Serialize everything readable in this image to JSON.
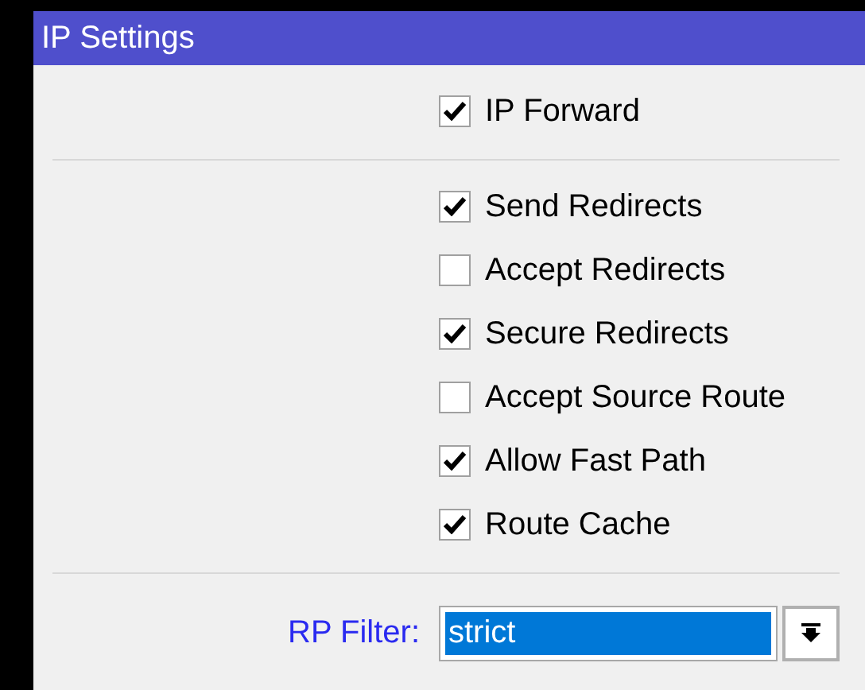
{
  "window": {
    "title": "IP Settings"
  },
  "general": [
    {
      "label": "IP Forward",
      "checked": true
    }
  ],
  "options": [
    {
      "label": "Send Redirects",
      "checked": true
    },
    {
      "label": "Accept Redirects",
      "checked": false
    },
    {
      "label": "Secure Redirects",
      "checked": true
    },
    {
      "label": "Accept Source Route",
      "checked": false
    },
    {
      "label": "Allow Fast Path",
      "checked": true
    },
    {
      "label": "Route Cache",
      "checked": true
    }
  ],
  "rp_filter": {
    "label": "RP Filter:",
    "value": "strict",
    "highlighted": true
  }
}
